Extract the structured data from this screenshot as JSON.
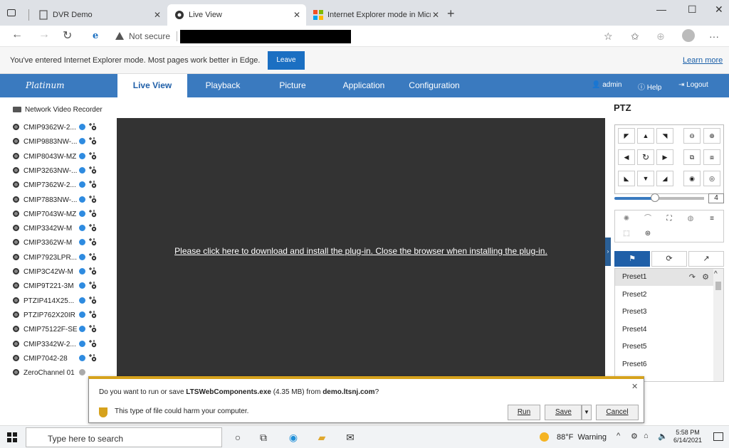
{
  "browser": {
    "tabs": [
      {
        "label": "DVR Demo"
      },
      {
        "label": "Live View"
      },
      {
        "label": "Internet Explorer mode in Micros"
      }
    ],
    "close_glyph": "✕",
    "new_tab_glyph": "+",
    "window_controls": [
      "—",
      "☐",
      "✕"
    ],
    "security_label": "Not secure",
    "ie_banner_text": "You've entered Internet Explorer mode. Most pages work better in Edge.",
    "leave_label": "Leave",
    "learn_more_label": "Learn more"
  },
  "app": {
    "logo_text": "Platinum",
    "nav_tabs": [
      "Live View",
      "Playback",
      "Picture",
      "Application",
      "Configuration"
    ],
    "active_tab": "Live View",
    "user_links": {
      "admin": "admin",
      "help": "Help",
      "logout": "Logout"
    },
    "tree_root": "Network Video Recorder",
    "cameras": [
      {
        "name": "CMIP9362W-2..."
      },
      {
        "name": "CMIP9883NW-..."
      },
      {
        "name": "CMIP8043W-MZ"
      },
      {
        "name": "CMIP3263NW-..."
      },
      {
        "name": "CMIP7362W-2..."
      },
      {
        "name": "CMIP7883NW-..."
      },
      {
        "name": "CMIP7043W-MZ"
      },
      {
        "name": "CMIP3342W-M"
      },
      {
        "name": "CMIP3362W-M"
      },
      {
        "name": "CMIP7923LPR..."
      },
      {
        "name": "CMIP3C42W-M"
      },
      {
        "name": "CMIP9T221-3M"
      },
      {
        "name": "PTZIP414X25..."
      },
      {
        "name": "PTZIP762X20IR"
      },
      {
        "name": "CMIP75122F-SE"
      },
      {
        "name": "CMIP3342W-2..."
      },
      {
        "name": "CMIP7042-28"
      },
      {
        "name": "ZeroChannel 01"
      }
    ],
    "plugin_message": "Please click here to download and install the plug-in. Close the browser when installing the plug-in."
  },
  "ptz": {
    "title": "PTZ",
    "speed": "4",
    "speed_level_fraction": 0.45,
    "presets": [
      "Preset1",
      "Preset2",
      "Preset3",
      "Preset4",
      "Preset5",
      "Preset6"
    ],
    "selected_preset": "Preset1"
  },
  "download": {
    "question_prefix": "Do you want to run or save ",
    "file_name": "LTSWebComponents.exe",
    "file_size": " (4.35 MB) from ",
    "host": "demo.ltsnj.com",
    "question_suffix": "?",
    "warning": "This type of file could harm your computer.",
    "run_label": "Run",
    "save_label": "Save",
    "cancel_label": "Cancel"
  },
  "taskbar": {
    "search_placeholder": "Type here to search",
    "temperature": "88°F",
    "weather_text": "Warning",
    "time": "5:58 PM",
    "date": "6/14/2021"
  },
  "colors": {
    "nav_blue": "#3a7abf",
    "accent_blue": "#1f5fa8",
    "video_bg": "#333333",
    "warning_gold": "#d6a21c"
  }
}
